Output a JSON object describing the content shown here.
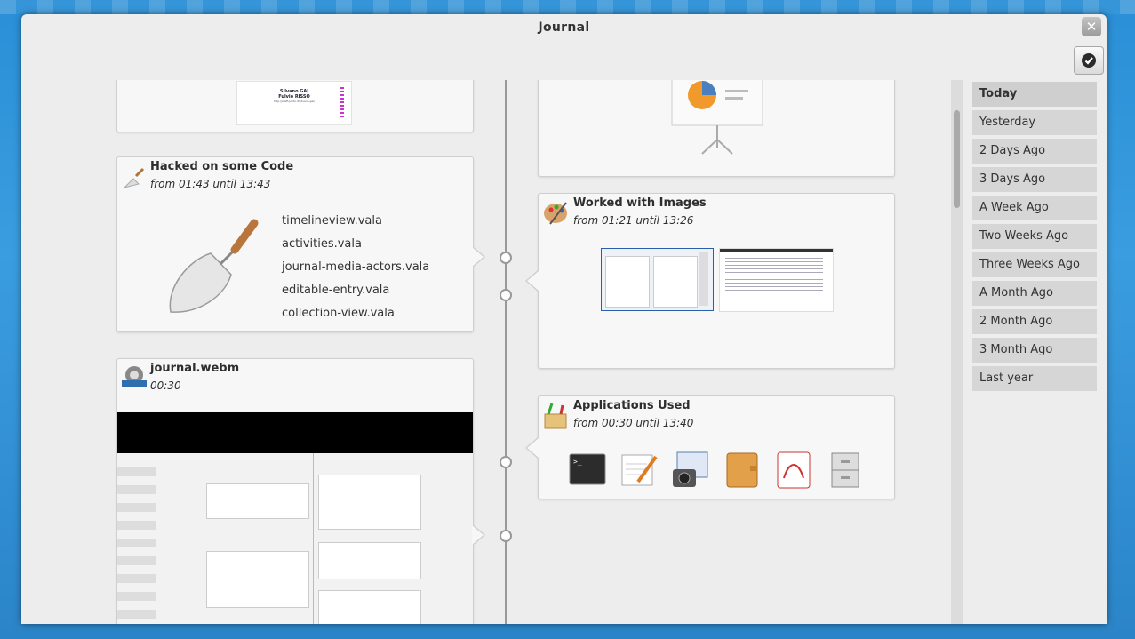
{
  "window": {
    "title": "Journal"
  },
  "cards": {
    "partial_top_left": {
      "line1": "Silvano GAI",
      "line2": "Fulvio RISSO",
      "line3": "http://staff.polito.it/silvano.gai/"
    },
    "code": {
      "title": "Hacked on some Code",
      "time_from": "from 01:43",
      "until": "until",
      "time_to": "13:43",
      "files": [
        "timelineview.vala",
        "activities.vala",
        "journal-media-actors.vala",
        "editable-entry.vala",
        "collection-view.vala"
      ]
    },
    "video": {
      "title": "journal.webm",
      "duration": "00:30"
    },
    "images": {
      "title": "Worked with Images",
      "time_from": "from 01:21",
      "until": "until",
      "time_to": "13:26"
    },
    "apps": {
      "title": "Applications Used",
      "time_from": "from 00:30",
      "until": "until",
      "time_to": "13:40",
      "icons": [
        "terminal-icon",
        "text-editor-icon",
        "screenshot-icon",
        "address-book-icon",
        "pdf-reader-icon",
        "file-cabinet-icon"
      ]
    }
  },
  "sidebar": {
    "items": [
      {
        "label": "Today"
      },
      {
        "label": "Yesterday"
      },
      {
        "label": "2 Days Ago"
      },
      {
        "label": "3 Days Ago"
      },
      {
        "label": "A Week Ago"
      },
      {
        "label": "Two Weeks Ago"
      },
      {
        "label": "Three Weeks Ago"
      },
      {
        "label": "A Month Ago"
      },
      {
        "label": "2 Month Ago"
      },
      {
        "label": "3 Month Ago"
      },
      {
        "label": "Last year"
      }
    ]
  }
}
